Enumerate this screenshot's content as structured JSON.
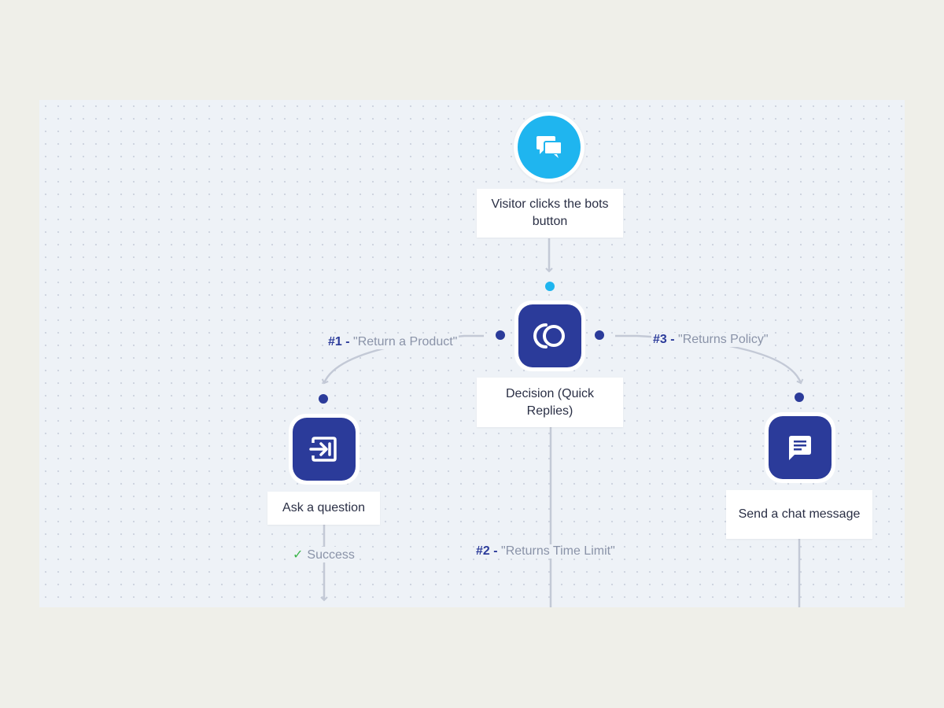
{
  "nodes": {
    "start": {
      "label": "Visitor clicks the bots button",
      "icon": "chat-bubbles-icon"
    },
    "decision": {
      "label": "Decision (Quick Replies)",
      "icon": "decision-circles-icon"
    },
    "ask": {
      "label": "Ask a question",
      "icon": "input-arrow-icon"
    },
    "send": {
      "label": "Send a chat message",
      "icon": "chat-message-icon"
    }
  },
  "branches": {
    "b1": {
      "num": "#1 -",
      "text": "\"Return a Product\""
    },
    "b2": {
      "num": "#2 -",
      "text": "\"Returns Time Limit\""
    },
    "b3": {
      "num": "#3 -",
      "text": "\"Returns Policy\""
    }
  },
  "success_label": "Success",
  "colors": {
    "cyan": "#1fb5ef",
    "navy": "#2b3b9a",
    "wire": "#c3c9d6",
    "success": "#3bb54a"
  }
}
